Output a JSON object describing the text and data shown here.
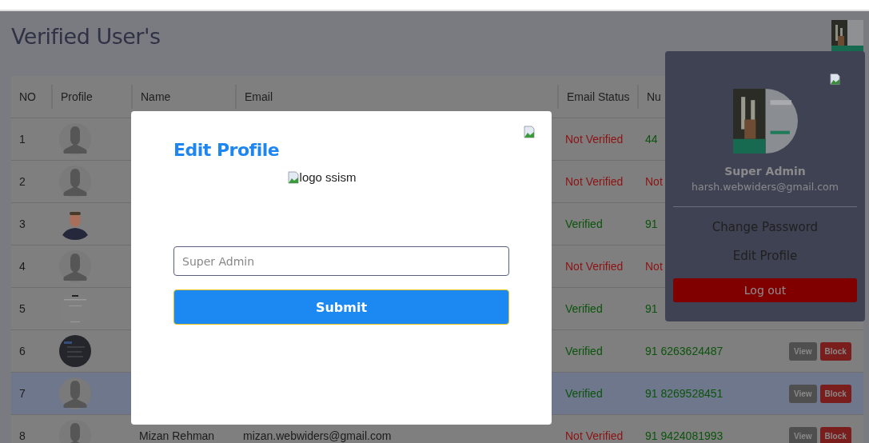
{
  "page": {
    "title": "Verified User's"
  },
  "table": {
    "columns": [
      "NO",
      "Profile",
      "Name",
      "Email",
      "Email Status",
      "Nu"
    ],
    "rows": [
      {
        "no": "1",
        "profile": {
          "kind": "silhouette"
        },
        "status": "Not Verified",
        "verified": false,
        "number": "44",
        "number_ok": true,
        "selected": false,
        "actions": []
      },
      {
        "no": "2",
        "profile": {
          "kind": "silhouette"
        },
        "status": "Not Verified",
        "verified": false,
        "number": "Not",
        "number_ok": false,
        "selected": false,
        "actions": []
      },
      {
        "no": "3",
        "status": "Verified",
        "verified": true,
        "number": "91",
        "number_ok": true,
        "selected": false,
        "actions": []
      },
      {
        "no": "4",
        "profile": {
          "kind": "silhouette"
        },
        "status": "Not Verified",
        "verified": false,
        "number": "Not",
        "number_ok": false,
        "selected": false,
        "actions": []
      },
      {
        "no": "5",
        "status": "Verified",
        "verified": true,
        "number": "91",
        "number_ok": true,
        "selected": false,
        "actions": []
      },
      {
        "no": "6",
        "status": "Verified",
        "verified": true,
        "number": "91 6263624487",
        "number_ok": true,
        "selected": false,
        "actions": [
          {
            "label": "View",
            "kind": "view"
          },
          {
            "label": "Block",
            "kind": "block"
          }
        ]
      },
      {
        "no": "7",
        "profile": {
          "kind": "silhouette"
        },
        "status": "Verified",
        "verified": true,
        "number": "91 8269528451",
        "number_ok": true,
        "selected": true,
        "actions": [
          {
            "label": "View",
            "kind": "view"
          },
          {
            "label": "Block",
            "kind": "block"
          }
        ]
      },
      {
        "no": "8",
        "profile": {
          "kind": "silhouette"
        },
        "name": "Mizan Rehman",
        "email": "mizan.webwiders@gmail.com",
        "status": "Not Verified",
        "verified": false,
        "number": "91 9424081993",
        "number_ok": true,
        "selected": false,
        "actions": [
          {
            "label": "View",
            "kind": "view"
          },
          {
            "label": "Block",
            "kind": "block"
          }
        ]
      }
    ]
  },
  "account_menu": {
    "name": "Super Admin",
    "email": "harsh.webwiders@gmail.com",
    "items": [
      "Change Password",
      "Edit Profile"
    ],
    "logout": "Log out"
  },
  "modal": {
    "title": "Edit Profile",
    "logo_alt": "logo ssism",
    "field": {
      "placeholder": "Super Admin"
    },
    "submit": "Submit"
  }
}
